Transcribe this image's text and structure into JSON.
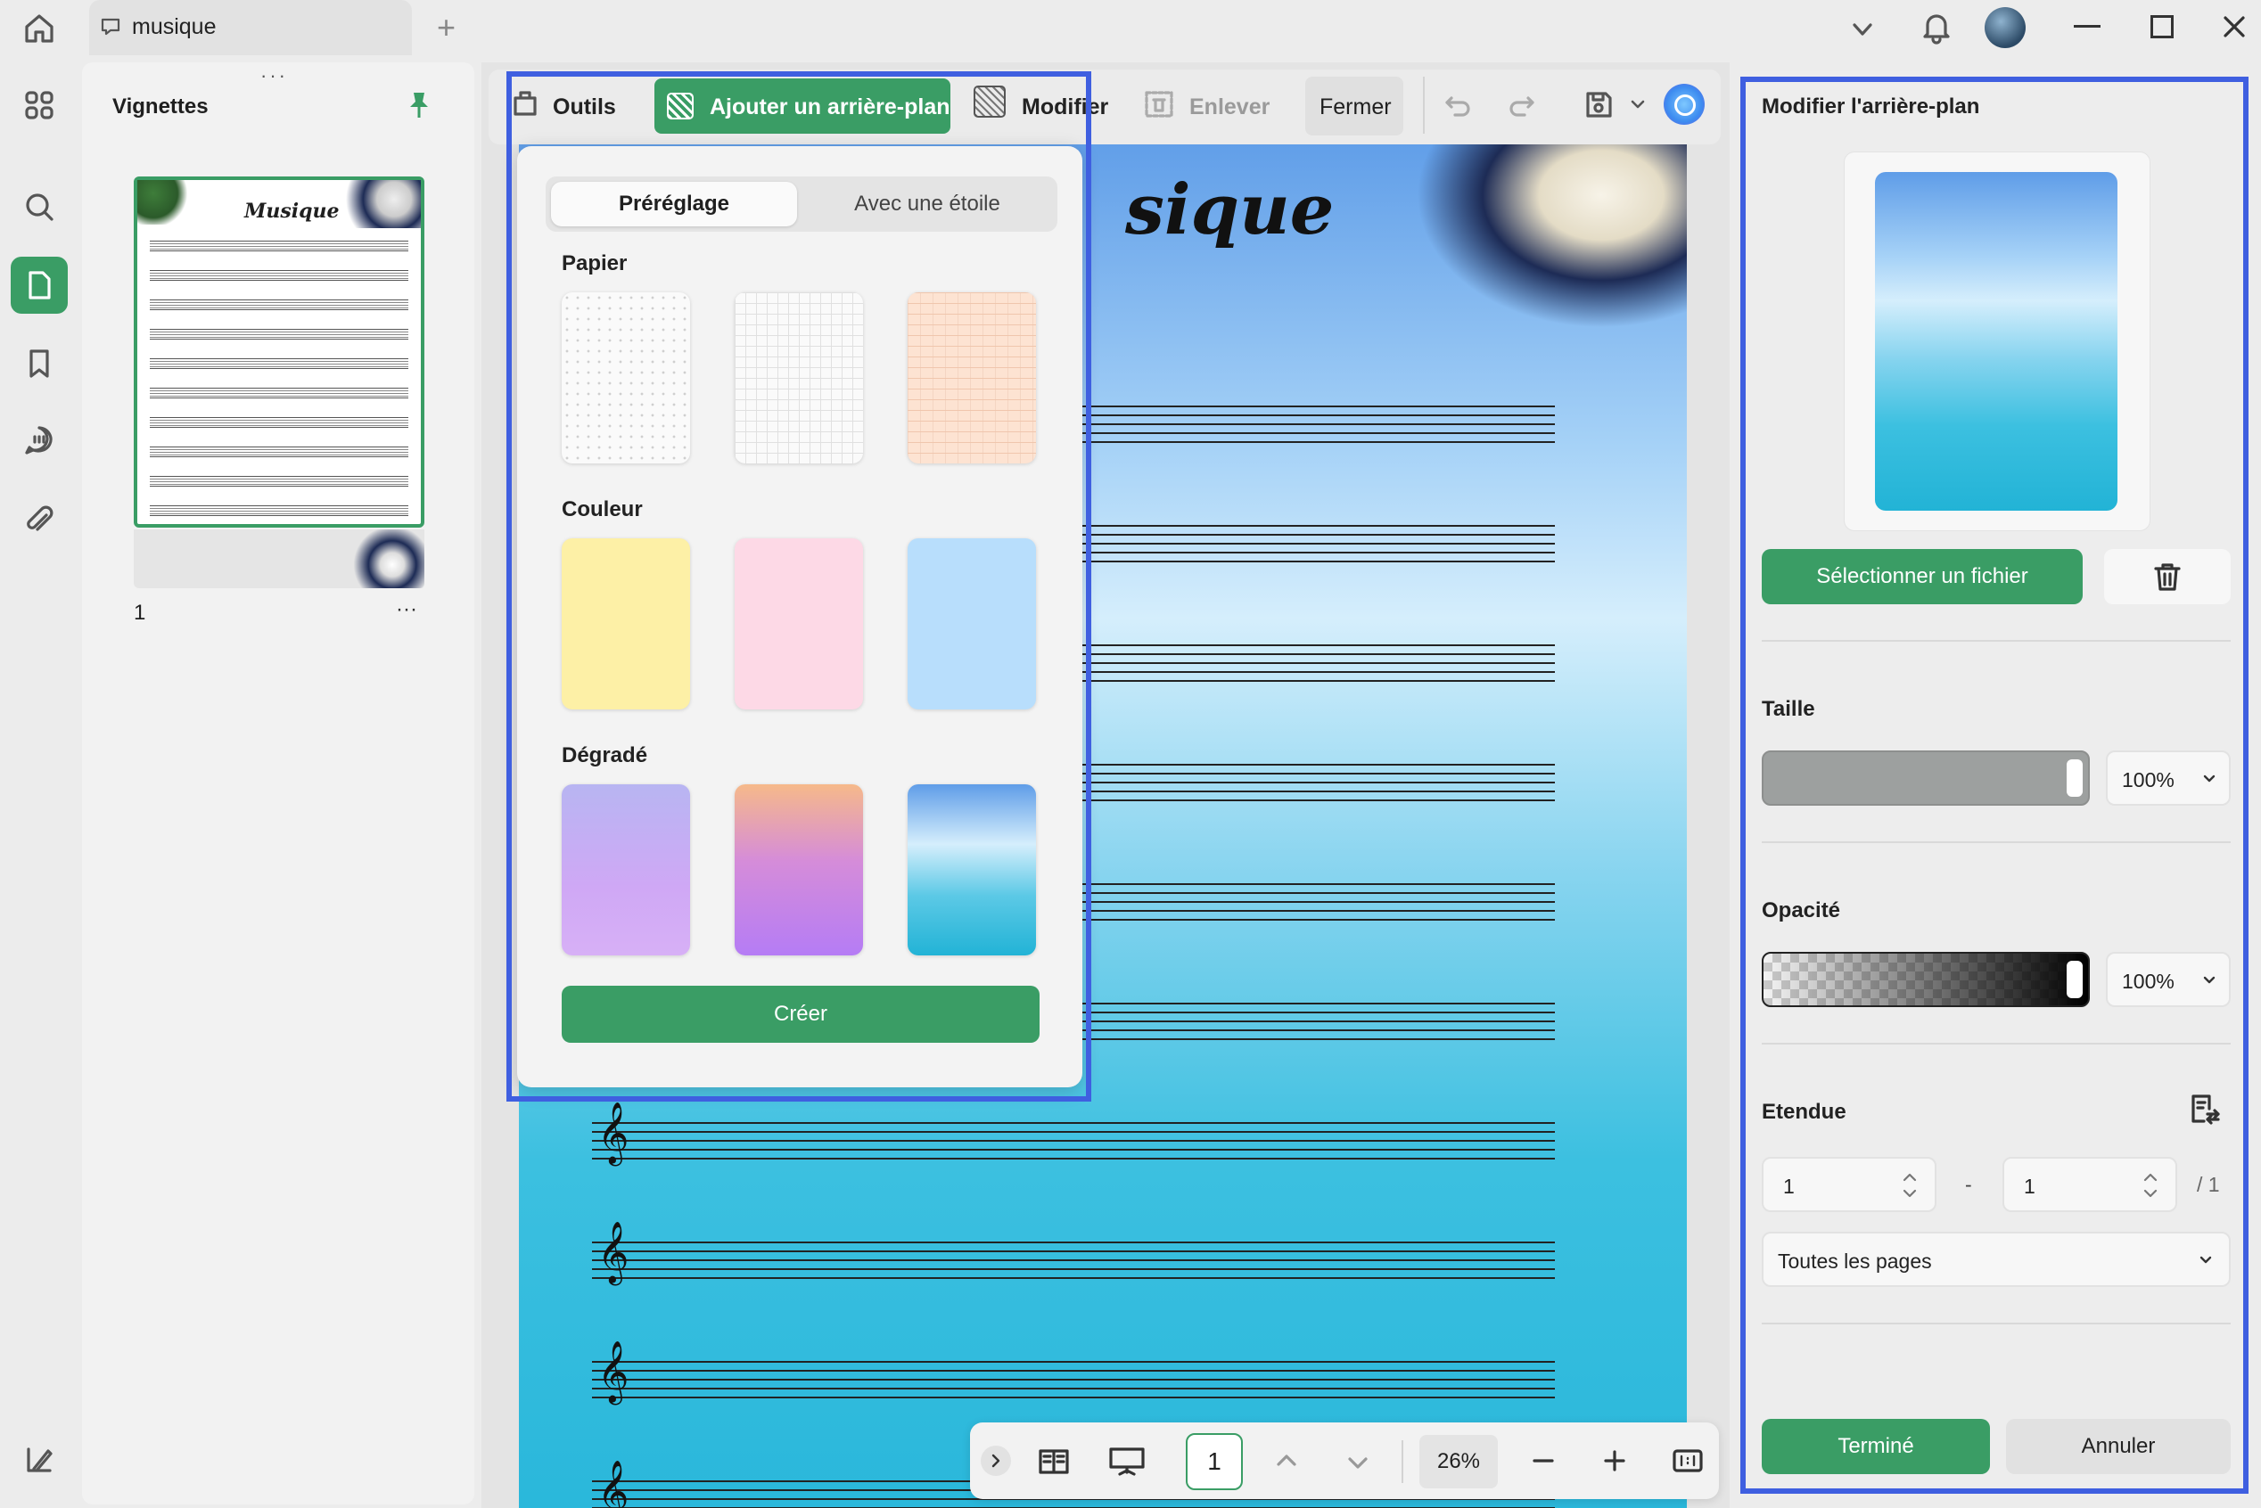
{
  "window": {
    "tab_title": "musique",
    "new_tab": "+"
  },
  "thumbnails": {
    "title": "Vignettes",
    "page_number": "1",
    "more": "···",
    "thumb_title": "Musique"
  },
  "document": {
    "title_fragment": "sique"
  },
  "toolbar": {
    "outils": "Outils",
    "ajouter": "Ajouter un arrière-plan",
    "modifier": "Modifier",
    "enlever": "Enlever",
    "fermer": "Fermer"
  },
  "popup": {
    "tabs": [
      "Préréglage",
      "Avec une étoile"
    ],
    "active_tab": "Préréglage",
    "section_papier": "Papier",
    "section_couleur": "Couleur",
    "section_degrade": "Dégradé",
    "colors": [
      "#fdf0a6",
      "#fdd9e6",
      "#b8defc"
    ],
    "create_button": "Créer"
  },
  "right_panel": {
    "title": "Modifier l'arrière-plan",
    "select_file": "Sélectionner un fichier",
    "taille_label": "Taille",
    "taille_value": "100%",
    "taille_level": 1.0,
    "opacite_label": "Opacité",
    "opacite_value": "100%",
    "opacite_level": 1.0,
    "etendue_label": "Etendue",
    "range_from": "1",
    "range_sep": "-",
    "range_to": "1",
    "range_total": "/ 1",
    "pages_option": "Toutes les pages",
    "done": "Terminé",
    "cancel": "Annuler"
  },
  "bottom_bar": {
    "page_input": "1",
    "zoom": "26%"
  },
  "colors": {
    "accent_green": "#3a9d65",
    "highlight_blue": "#3f5fe0"
  }
}
